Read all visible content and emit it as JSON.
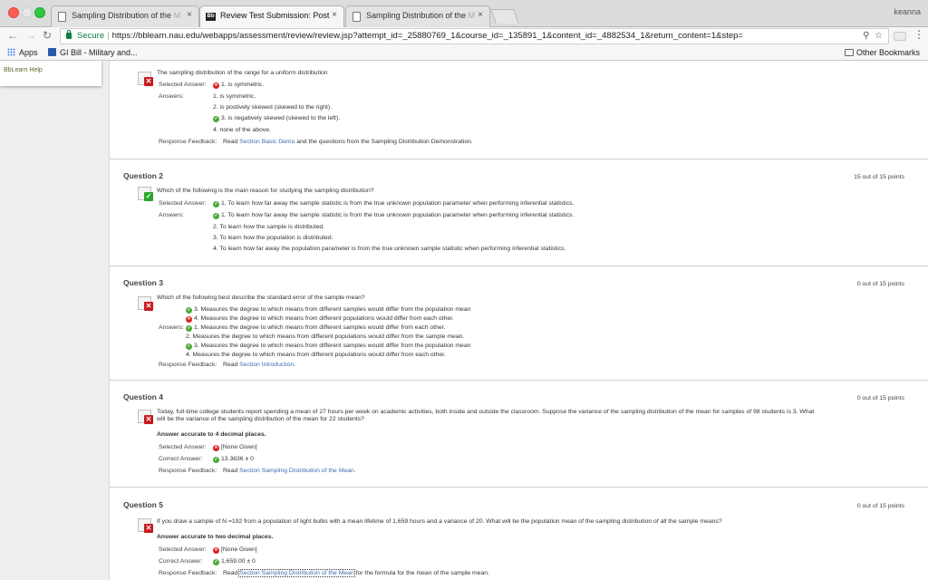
{
  "browser": {
    "tabs": [
      {
        "label": "Sampling Distribution of the",
        "fade": " M",
        "close": "×"
      },
      {
        "label": "Review Test Submission: Post",
        "fade": "",
        "close": "×",
        "favicon": "Bb"
      },
      {
        "label": "Sampling Distribution of the",
        "fade": " M",
        "close": "×"
      }
    ],
    "profile": "keanna",
    "address": {
      "secure_label": "Secure",
      "separator": "|",
      "url": "https://bblearn.nau.edu/webapps/assessment/review/review.jsp?attempt_id=_25880769_1&course_id=_135891_1&content_id=_4882534_1&return_content=1&step="
    },
    "bookmarks": {
      "apps": "Apps",
      "gi_bill": "GI Bill - Military and...",
      "other": "Other Bookmarks"
    }
  },
  "sidebar": {
    "help": "BbLearn Help"
  },
  "q1": {
    "prompt": "The sampling distribution of the range for a uniform distribution",
    "selected_label": "Selected Answer:",
    "selected": "1. is symmetric.",
    "answers_label": "Answers:",
    "answers": [
      "1. is symmetric.",
      "2. is postively skewed (skewed to the right).",
      "3. is negatively skewed (skewed to the left).",
      "4. none of the above."
    ],
    "feedback_label": "Response Feedback:",
    "feedback_pre": "Read ",
    "feedback_link": "Section Basic Demo",
    "feedback_post": " and the questions from the Sampling Distribution Demonstration."
  },
  "q2": {
    "title": "Question 2",
    "points": "15 out of 15 points",
    "prompt": "Which of the following is the main reason for studying the sampling distribution?",
    "selected_label": "Selected Answer:",
    "selected": "1. To learn how far away the sample statistic is from the true unknown population parameter when performing inferential statistics.",
    "answers_label": "Answers:",
    "answers": [
      "1. To learn how far away the sample statistic is from the true unknown population parameter when performing inferential statistics.",
      "2. To learn how the sample is distributed.",
      "3. To learn how the population is distributed.",
      "4. To learn how far away the population parameter is from the true unknown sample statistic when performing inferential statistics."
    ]
  },
  "q3": {
    "title": "Question 3",
    "points": "0 out of 15 points",
    "prompt": "Which of the following best describe the standard error of the sample mean?",
    "selected": [
      "3. Measures the degree to which means from different samples would differ from the population mean",
      "4. Measures the degree to which means from different populations would differ from each other."
    ],
    "answers_label": "Answers:",
    "answers": [
      "1. Measures the degree to which means from different samples would differ from each other.",
      "2. Measures the degree to which means from different populations would differ from the sample mean.",
      "3. Measures the degree to which means from different samples would differ from the population mean",
      "4. Measures the degree to which means from different populations would differ from each other."
    ],
    "feedback_label": "Response Feedback:",
    "feedback_pre": "Read ",
    "feedback_link": "Section Introduction",
    "feedback_post": "."
  },
  "q4": {
    "title": "Question 4",
    "points": "0 out of 15 points",
    "prompt_line1": "Today, full-time college students report spending a mean of 27 hours per week on academic activities, both inside and outside the classroom.  Suppose the variance of the sampling distribution of the mean for samples of 98 students is 3. What",
    "prompt_line2": "will be the variance of the sampling distribution of the mean for 22 students?",
    "accuracy": "Answer accurate to 4 decimal places.",
    "selected_label": "Selected Answer:",
    "selected": "[None Given]",
    "correct_label": "Correct Answer:",
    "correct": "13.3636 ± 0",
    "feedback_label": "Response Feedback:",
    "feedback_pre": "Read ",
    "feedback_link": "Section Sampling Distribution of the Mean",
    "feedback_post": "."
  },
  "q5": {
    "title": "Question 5",
    "points": "0 out of 15 points",
    "prompt": "If you draw a sample of N =192 from a population of light bulbs with a mean lifetime of 1,659 hours and a variance of 20. What will be the population mean of the sampling distribution of all the sample means?",
    "accuracy": "Answer accurate to two decimal places.",
    "selected_label": "Selected Answer:",
    "selected": "[None Given]",
    "correct_label": "Correct Answer:",
    "correct": "1,659.00 ± 0",
    "feedback_label": "Response Feedback:",
    "feedback_pre": "Read ",
    "feedback_link": "Section Sampling Distribution of the Mean",
    "feedback_post": " for the formula for the mean of the sample mean."
  },
  "colors": {
    "correct": "#4fa83a",
    "incorrect": "#d9221c",
    "link": "#3a6fb0",
    "secure": "#0b8043"
  }
}
